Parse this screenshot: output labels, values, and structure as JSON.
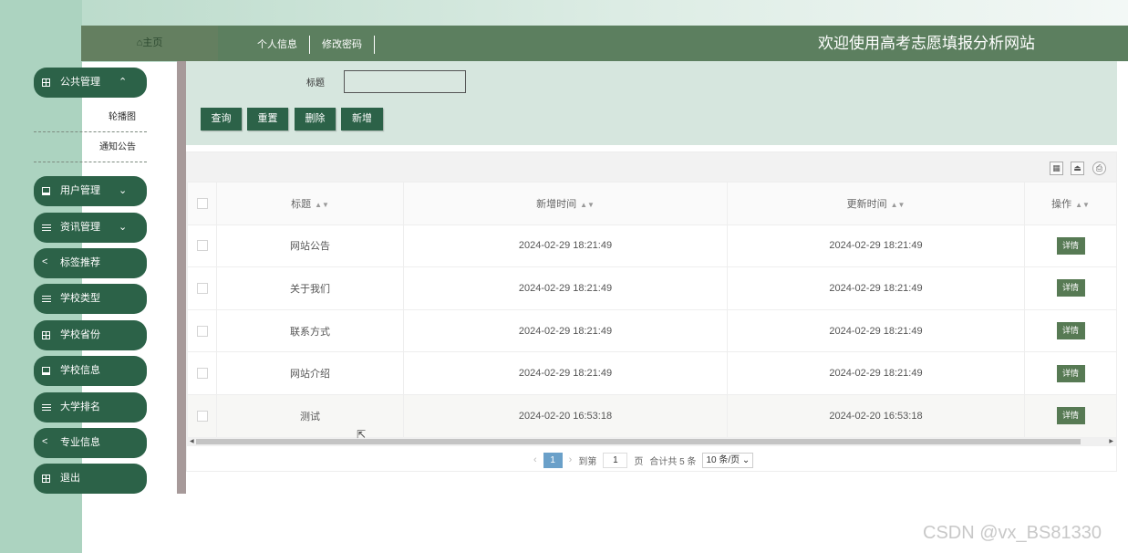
{
  "header": {
    "home_label": "⌂主页",
    "nav": [
      "个人信息",
      "修改密码"
    ],
    "site_title": "欢迎使用高考志愿填报分析网站"
  },
  "sidebar": {
    "menus": [
      {
        "label": "公共管理",
        "icon": "grid-icon",
        "chevron": "up"
      },
      {
        "label": "用户管理",
        "icon": "book-icon",
        "chevron": "down"
      },
      {
        "label": "资讯管理",
        "icon": "list-icon",
        "chevron": "down"
      },
      {
        "label": "标签推荐",
        "icon": "share-icon"
      },
      {
        "label": "学校类型",
        "icon": "list-icon"
      },
      {
        "label": "学校省份",
        "icon": "grid-icon"
      },
      {
        "label": "学校信息",
        "icon": "book-icon"
      },
      {
        "label": "大学排名",
        "icon": "list-icon"
      },
      {
        "label": "专业信息",
        "icon": "share-icon"
      },
      {
        "label": "退出",
        "icon": "grid-icon"
      }
    ],
    "submenu": [
      "轮播图",
      "通知公告"
    ],
    "chevron_up": "⌃",
    "chevron_down": "⌄"
  },
  "search": {
    "title_label": "标题",
    "title_value": "",
    "buttons": {
      "query": "查询",
      "reset": "重置",
      "delete": "删除",
      "add": "新增"
    }
  },
  "table": {
    "columns": [
      "标题",
      "新增时间",
      "更新时间",
      "操作"
    ],
    "rows": [
      {
        "title": "网站公告",
        "created": "2024-02-29 18:21:49",
        "updated": "2024-02-29 18:21:49",
        "action": "详情"
      },
      {
        "title": "关于我们",
        "created": "2024-02-29 18:21:49",
        "updated": "2024-02-29 18:21:49",
        "action": "详情"
      },
      {
        "title": "联系方式",
        "created": "2024-02-29 18:21:49",
        "updated": "2024-02-29 18:21:49",
        "action": "详情"
      },
      {
        "title": "网站介绍",
        "created": "2024-02-29 18:21:49",
        "updated": "2024-02-29 18:21:49",
        "action": "详情"
      },
      {
        "title": "测试",
        "created": "2024-02-20 16:53:18",
        "updated": "2024-02-20 16:53:18",
        "action": "详情"
      }
    ]
  },
  "pagination": {
    "prev": "‹",
    "current": "1",
    "next": "›",
    "goto_label": "到第",
    "goto_value": "1",
    "page_suffix": "页",
    "total": "合计共 5 条",
    "page_size": "10 条/页"
  },
  "watermark": "CSDN @vx_BS81330",
  "colors": {
    "primary": "#2c6248",
    "topbar": "#5c7f5f",
    "search_bg": "#d6e6de",
    "page_current": "#6aa0c9"
  }
}
